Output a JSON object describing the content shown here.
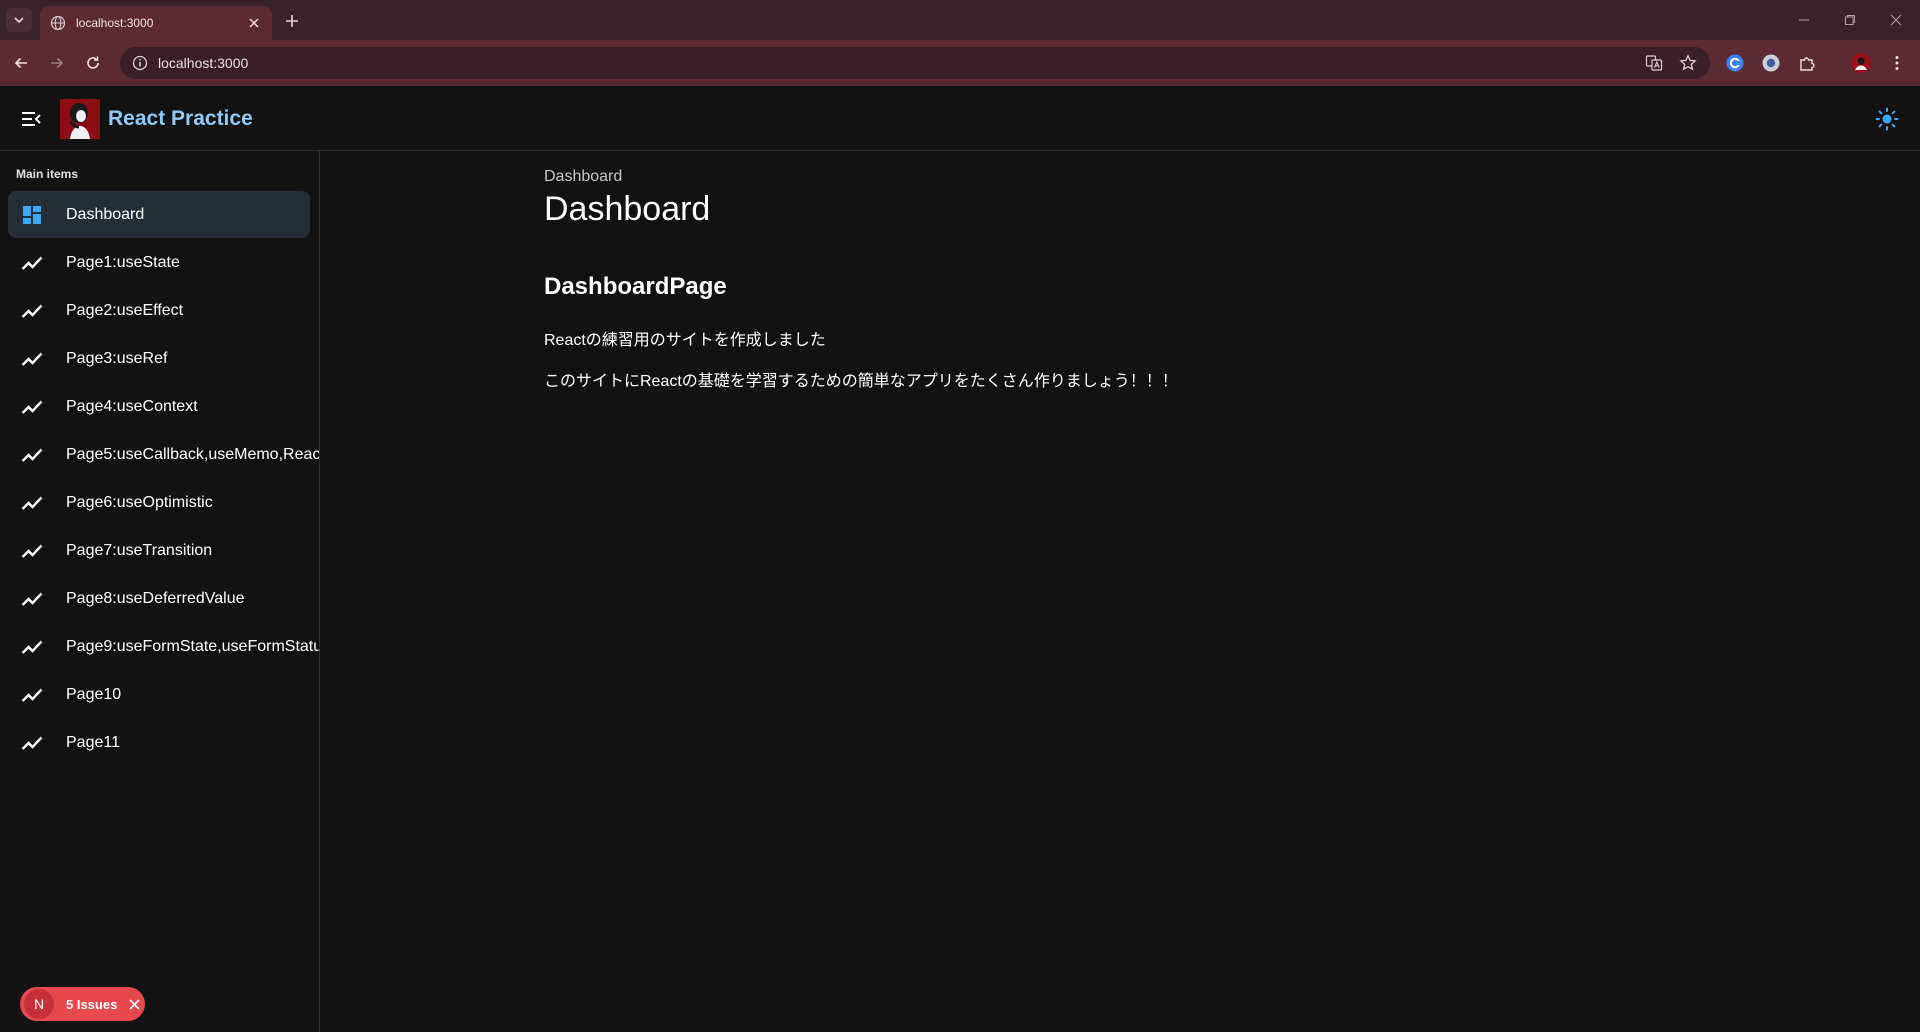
{
  "browser": {
    "tab_title": "localhost:3000",
    "url": "localhost:3000"
  },
  "app": {
    "title": "React Practice"
  },
  "sidebar": {
    "header": "Main items",
    "items": [
      {
        "label": "Dashboard",
        "icon": "dashboard-icon",
        "selected": true
      },
      {
        "label": "Page1:useState",
        "icon": "trending-up-icon"
      },
      {
        "label": "Page2:useEffect",
        "icon": "trending-up-icon"
      },
      {
        "label": "Page3:useRef",
        "icon": "trending-up-icon"
      },
      {
        "label": "Page4:useContext",
        "icon": "trending-up-icon"
      },
      {
        "label": "Page5:useCallback,useMemo,Reac",
        "icon": "trending-up-icon"
      },
      {
        "label": "Page6:useOptimistic",
        "icon": "trending-up-icon"
      },
      {
        "label": "Page7:useTransition",
        "icon": "trending-up-icon"
      },
      {
        "label": "Page8:useDeferredValue",
        "icon": "trending-up-icon"
      },
      {
        "label": "Page9:useFormState,useFormStatu",
        "icon": "trending-up-icon"
      },
      {
        "label": "Page10",
        "icon": "trending-up-icon"
      },
      {
        "label": "Page11",
        "icon": "trending-up-icon"
      }
    ]
  },
  "issues": {
    "n": "N",
    "label": "5 Issues"
  },
  "main": {
    "breadcrumb": "Dashboard",
    "title": "Dashboard",
    "section_title": "DashboardPage",
    "paragraph1": "Reactの練習用のサイトを作成しました",
    "paragraph2": "このサイトにReactの基礎を学習するための簡単なアプリをたくさん作りましょう！！！"
  },
  "colors": {
    "accent": "#90caf9",
    "background": "#121212",
    "selected": "#252d37",
    "browser_frame": "#5b2a33",
    "issues": "#e5484d"
  }
}
